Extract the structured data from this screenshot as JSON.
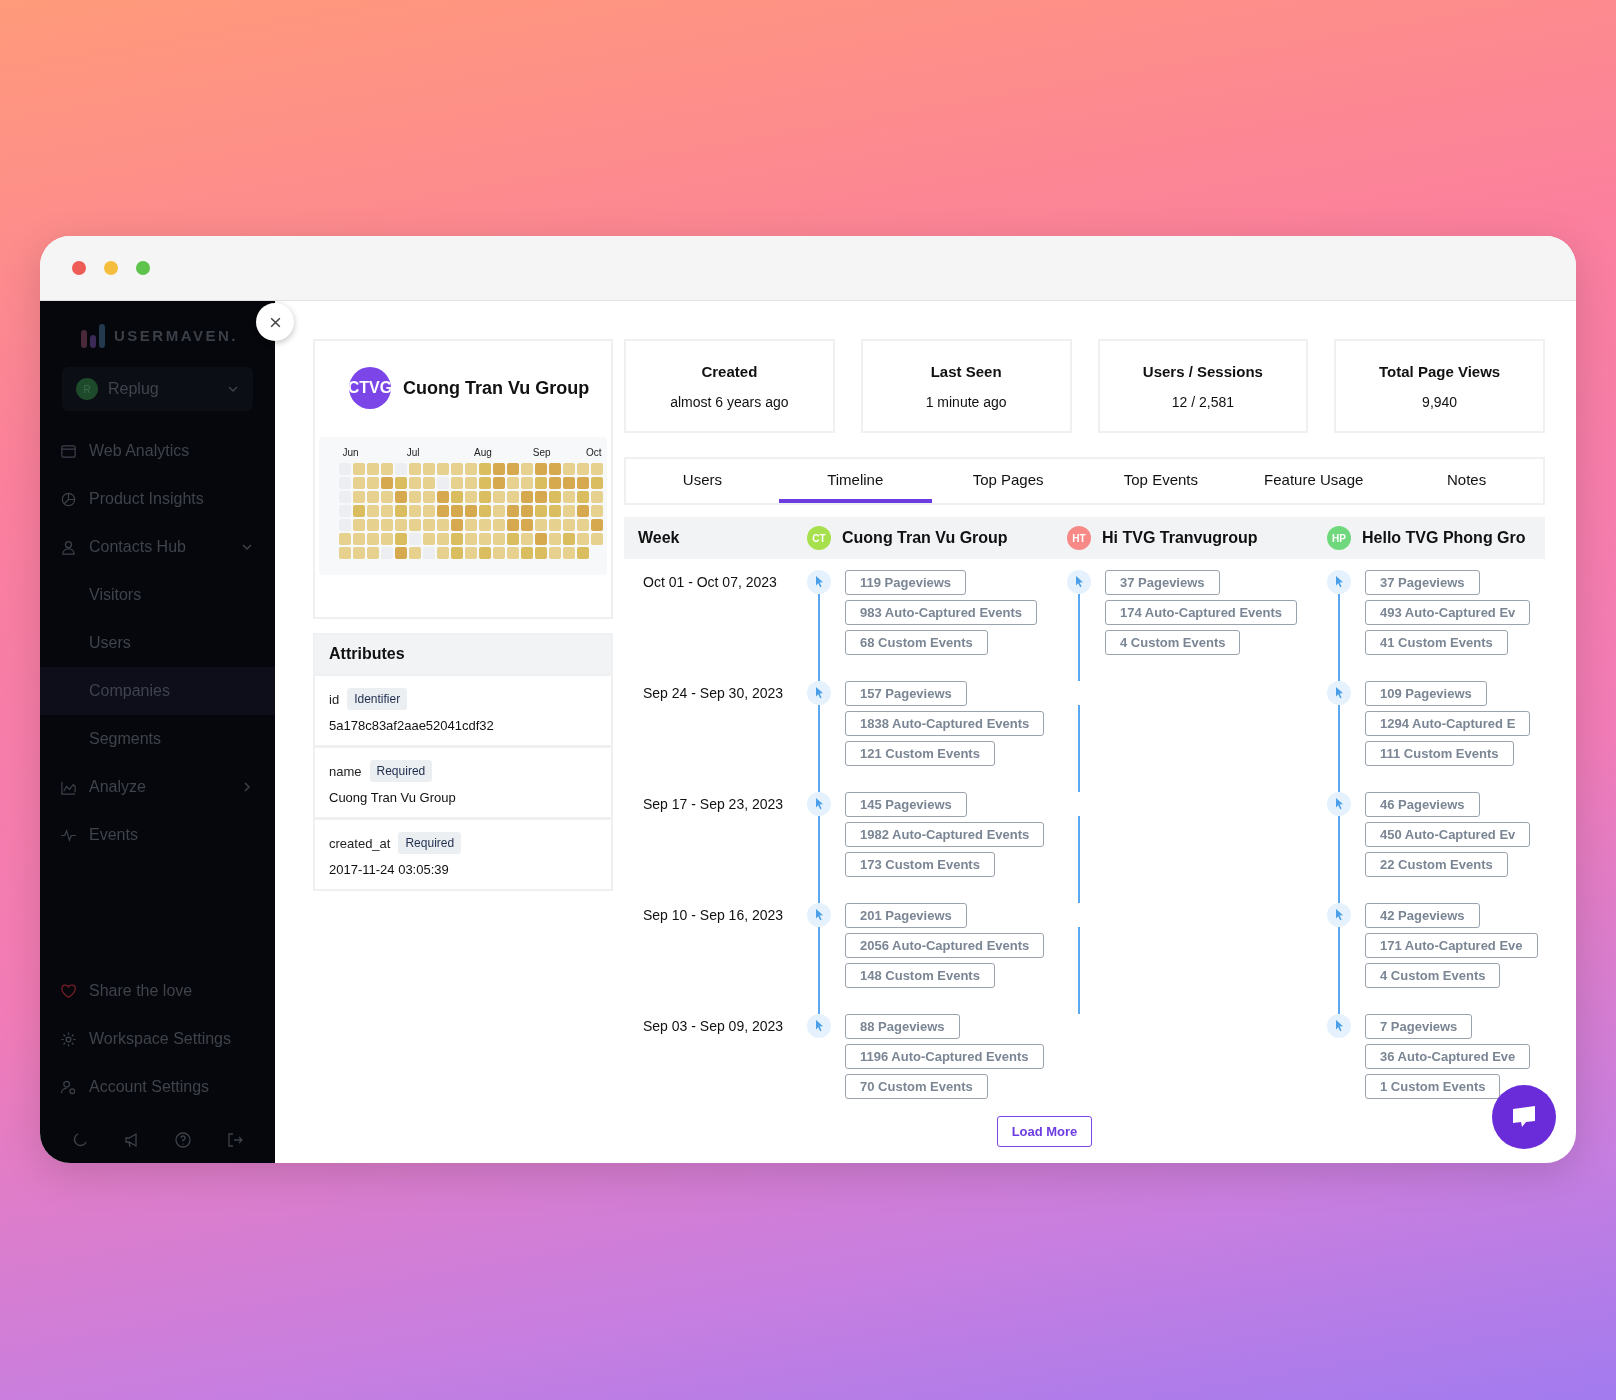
{
  "sidebar": {
    "logo": "USERMAVEN.",
    "workspace": {
      "initial": "R",
      "name": "Replug"
    },
    "nav": [
      {
        "kind": "browser",
        "label": "Web Analytics",
        "selected": false
      },
      {
        "kind": "pie",
        "label": "Product Insights",
        "selected": false
      },
      {
        "kind": "person",
        "label": "Contacts Hub",
        "selected": false,
        "expanded": true,
        "children": [
          {
            "label": "Visitors",
            "selected": false
          },
          {
            "label": "Users",
            "selected": false
          },
          {
            "label": "Companies",
            "selected": true
          },
          {
            "label": "Segments",
            "selected": false
          }
        ]
      },
      {
        "kind": "chart",
        "label": "Analyze",
        "selected": false,
        "expanded": false
      },
      {
        "kind": "pulse",
        "label": "Events",
        "selected": false
      }
    ],
    "bottom": [
      {
        "kind": "heart",
        "label": "Share the love"
      },
      {
        "kind": "gear",
        "label": "Workspace Settings"
      },
      {
        "kind": "user-gear",
        "label": "Account Settings"
      }
    ]
  },
  "profile": {
    "initials": "CTVG",
    "name": "Cuong Tran Vu Group",
    "months": [
      "Jun",
      "Jul",
      "Aug",
      "Sep",
      "Oct"
    ]
  },
  "stats": [
    {
      "label": "Created",
      "value": "almost 6 years ago"
    },
    {
      "label": "Last Seen",
      "value": "1 minute ago"
    },
    {
      "label": "Users / Sessions",
      "value": "12 / 2,581"
    },
    {
      "label": "Total Page Views",
      "value": "9,940"
    }
  ],
  "tabs": [
    {
      "label": "Users",
      "selected": false
    },
    {
      "label": "Timeline",
      "selected": true
    },
    {
      "label": "Top Pages",
      "selected": false
    },
    {
      "label": "Top Events",
      "selected": false
    },
    {
      "label": "Feature Usage",
      "selected": false
    },
    {
      "label": "Notes",
      "selected": false
    }
  ],
  "attributes": {
    "title": "Attributes",
    "items": [
      {
        "key": "id",
        "tag": "Identifier",
        "value": "5a178c83af2aae52041cdf32"
      },
      {
        "key": "name",
        "tag": "Required",
        "value": "Cuong Tran Vu Group"
      },
      {
        "key": "created_at",
        "tag": "Required",
        "value": "2017-11-24 03:05:39"
      }
    ]
  },
  "timeline": {
    "week_label": "Week",
    "weeks": [
      "Oct 01 - Oct 07, 2023",
      "Sep 24 - Sep 30, 2023",
      "Sep 17 - Sep 23, 2023",
      "Sep 10 - Sep 16, 2023",
      "Sep 03 - Sep 09, 2023"
    ],
    "groups": [
      {
        "initials": "CT",
        "name": "Cuong Tran Vu Group",
        "color": "#a6e04c",
        "weeks": [
          [
            "119 Pageviews",
            "983 Auto-Captured Events",
            "68 Custom Events"
          ],
          [
            "157 Pageviews",
            "1838 Auto-Captured Events",
            "121 Custom Events"
          ],
          [
            "145 Pageviews",
            "1982 Auto-Captured Events",
            "173 Custom Events"
          ],
          [
            "201 Pageviews",
            "2056 Auto-Captured Events",
            "148 Custom Events"
          ],
          [
            "88 Pageviews",
            "1196 Auto-Captured Events",
            "70 Custom Events"
          ]
        ]
      },
      {
        "initials": "HT",
        "name": "Hi TVG Tranvugroup",
        "color": "#f78a87",
        "weeks": [
          [
            "37 Pageviews",
            "174 Auto-Captured Events",
            "4 Custom Events"
          ]
        ]
      },
      {
        "initials": "HP",
        "name": "Hello TVG Phong Gro",
        "color": "#6fd87c",
        "weeks": [
          [
            "37 Pageviews",
            "493 Auto-Captured Ev",
            "41 Custom Events"
          ],
          [
            "109 Pageviews",
            "1294 Auto-Captured E",
            "111 Custom Events"
          ],
          [
            "46 Pageviews",
            "450 Auto-Captured Ev",
            "22 Custom Events"
          ],
          [
            "42 Pageviews",
            "171 Auto-Captured Eve",
            "4 Custom Events"
          ],
          [
            "7 Pageviews",
            "36 Auto-Captured Eve",
            "1 Custom Events"
          ]
        ]
      }
    ],
    "load_more": "Load More"
  }
}
